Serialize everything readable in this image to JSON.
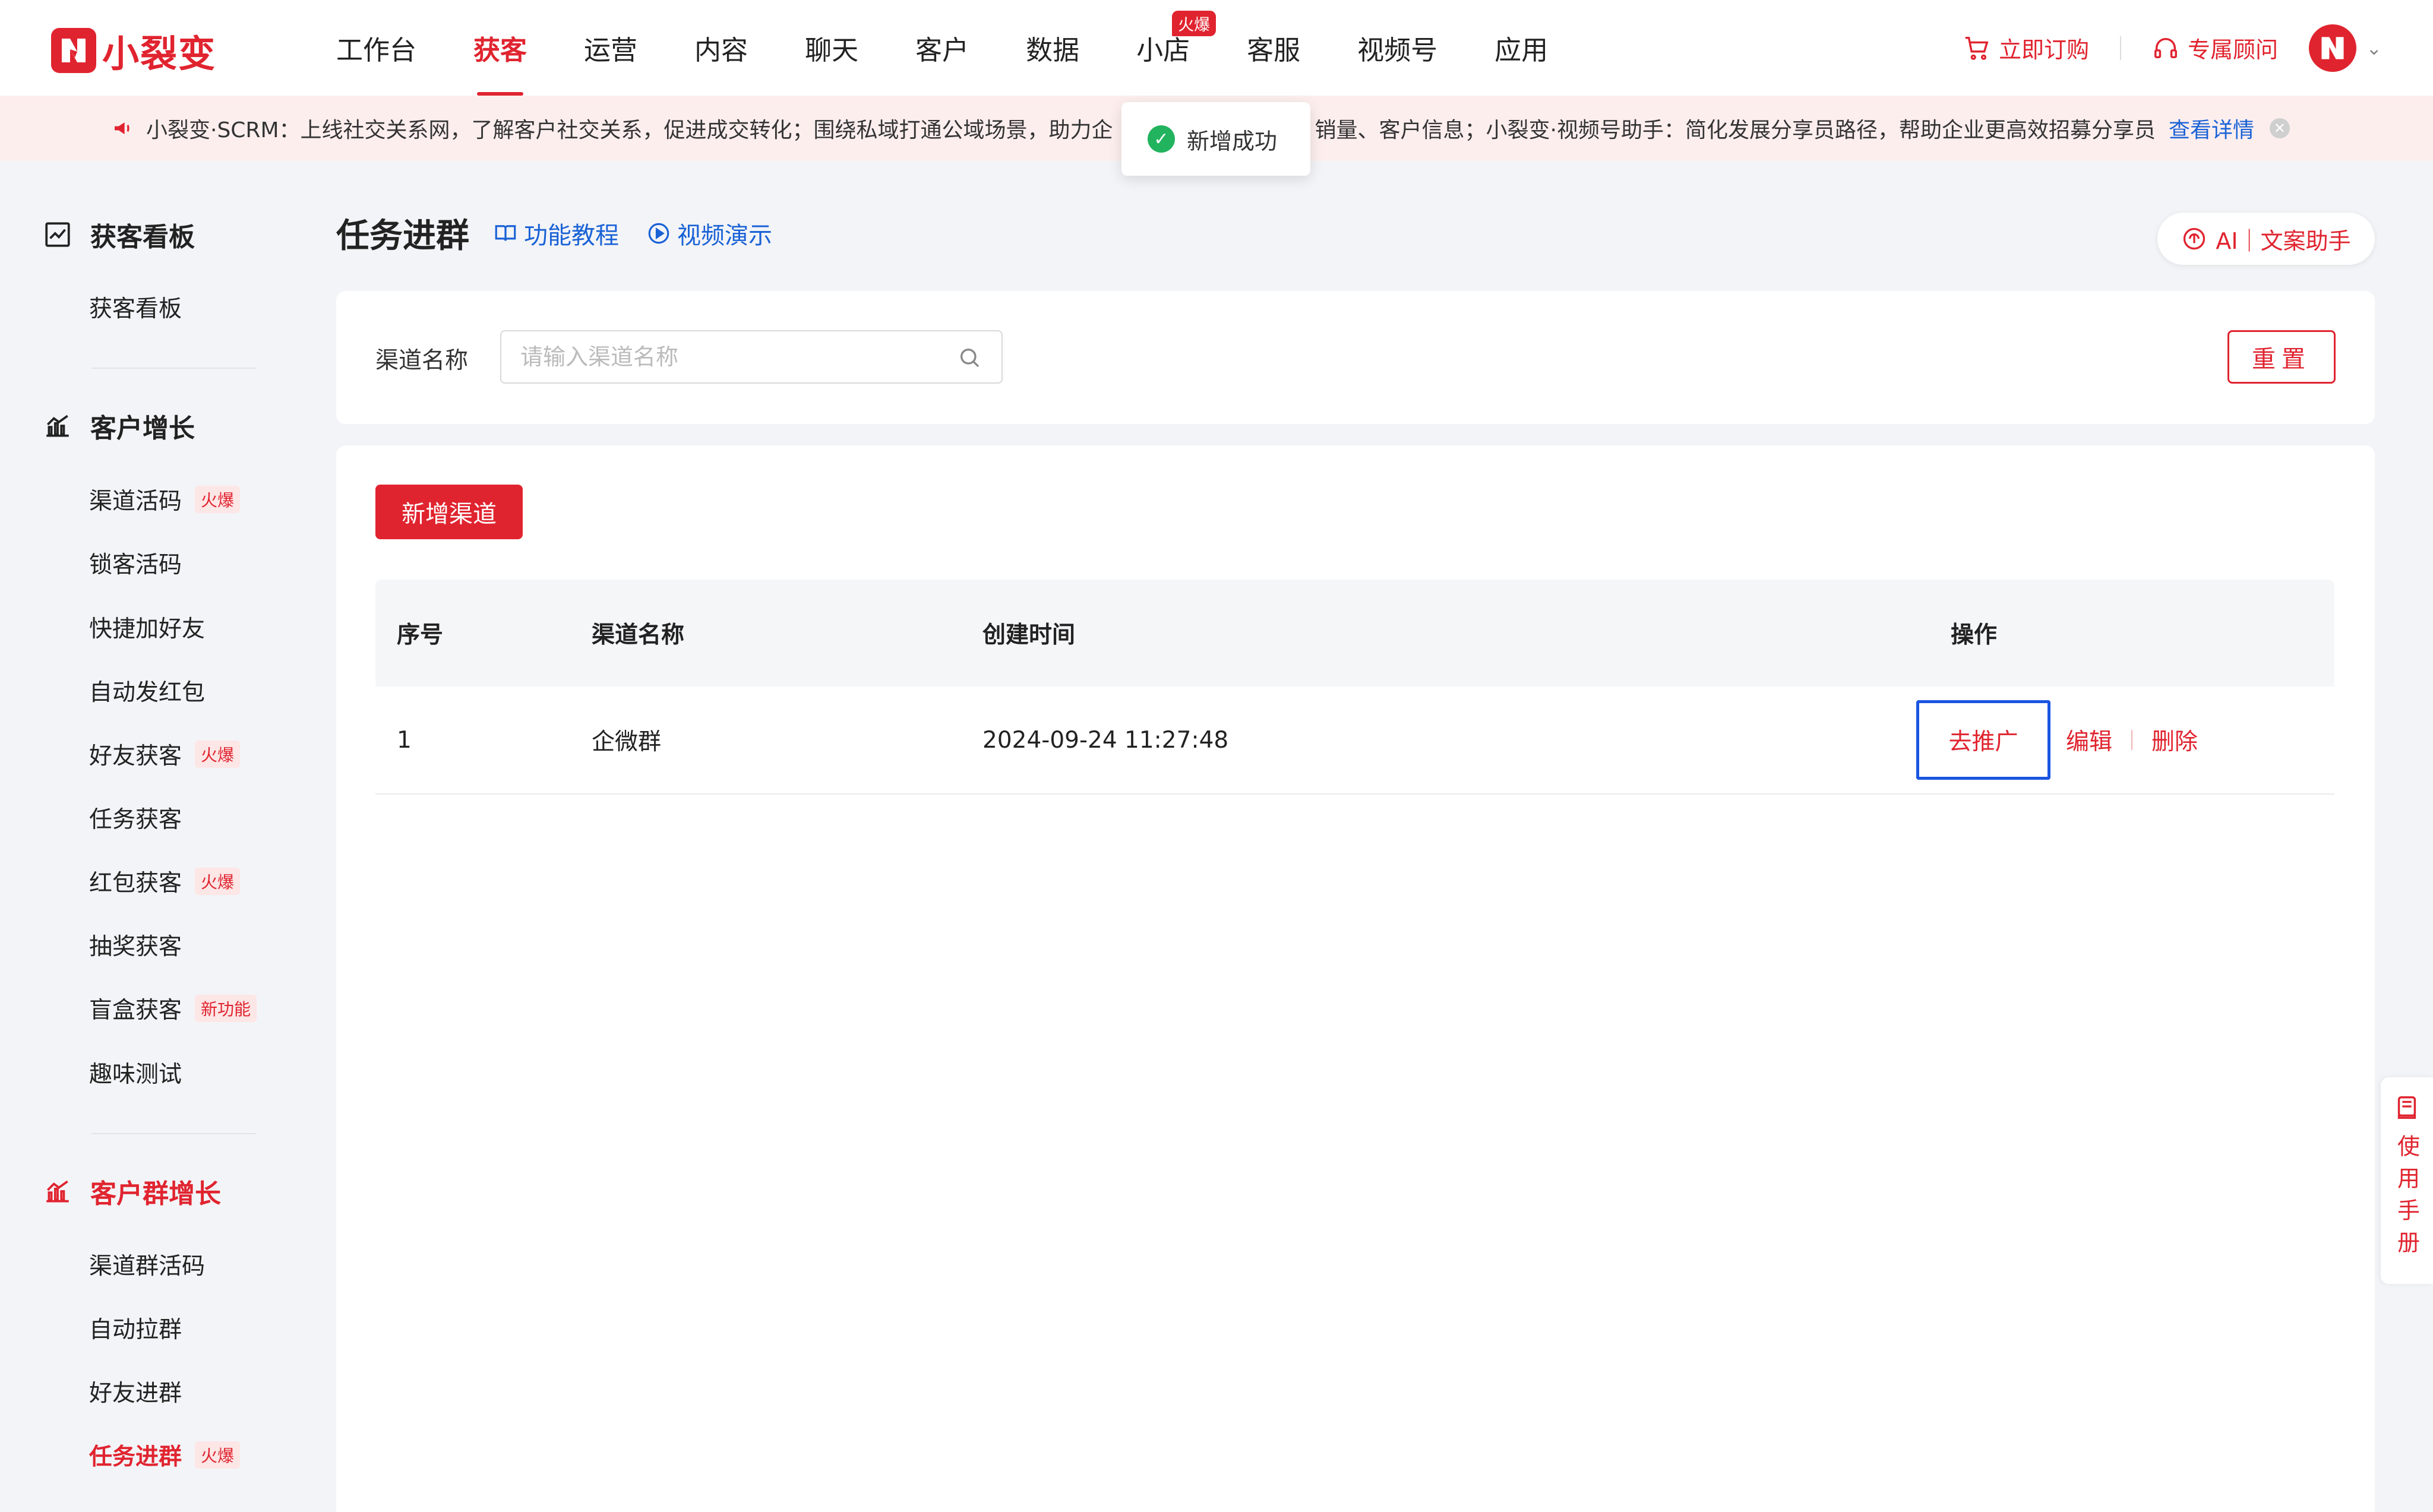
{
  "brand": {
    "name": "小裂变",
    "color": "#e0242f"
  },
  "nav": {
    "items": [
      {
        "label": "工作台"
      },
      {
        "label": "获客",
        "active": true
      },
      {
        "label": "运营"
      },
      {
        "label": "内容"
      },
      {
        "label": "聊天"
      },
      {
        "label": "客户"
      },
      {
        "label": "数据"
      },
      {
        "label": "小店",
        "badge": "火爆"
      },
      {
        "label": "客服"
      },
      {
        "label": "视频号"
      },
      {
        "label": "应用"
      }
    ],
    "order_label": "立即订购",
    "advisor_label": "专属顾问"
  },
  "notice": {
    "text_before": "小裂变·SCRM：上线社交关系网，了解客户社交关系，促进成交转化；围绕私域打通公域场景，助力企",
    "text_after": "销量、客户信息；小裂变·视频号助手：简化发展分享员路径，帮助企业更高效招募分享员",
    "link_label": "查看详情"
  },
  "toast": {
    "message": "新增成功"
  },
  "sidebar": {
    "groups": [
      {
        "title": "获客看板",
        "icon": "chart-line-icon",
        "items": [
          {
            "label": "获客看板"
          }
        ]
      },
      {
        "title": "客户增长",
        "icon": "growth-chart-icon",
        "items": [
          {
            "label": "渠道活码",
            "tag": "火爆"
          },
          {
            "label": "锁客活码"
          },
          {
            "label": "快捷加好友"
          },
          {
            "label": "自动发红包"
          },
          {
            "label": "好友获客",
            "tag": "火爆"
          },
          {
            "label": "任务获客"
          },
          {
            "label": "红包获客",
            "tag": "火爆"
          },
          {
            "label": "抽奖获客"
          },
          {
            "label": "盲盒获客",
            "tag": "新功能"
          },
          {
            "label": "趣味测试"
          }
        ]
      },
      {
        "title": "客户群增长",
        "icon": "growth-chart-icon",
        "active": true,
        "items": [
          {
            "label": "渠道群活码"
          },
          {
            "label": "自动拉群"
          },
          {
            "label": "好友进群"
          },
          {
            "label": "任务进群",
            "tag": "火爆",
            "active": true
          }
        ]
      }
    ]
  },
  "page": {
    "title": "任务进群",
    "tutorial_label": "功能教程",
    "video_label": "视频演示",
    "ai_label": "AI｜文案助手"
  },
  "filter": {
    "channel_label": "渠道名称",
    "channel_placeholder": "请输入渠道名称",
    "channel_value": "",
    "reset_label": "重置"
  },
  "table": {
    "add_label": "新增渠道",
    "columns": [
      "序号",
      "渠道名称",
      "创建时间",
      "操作"
    ],
    "rows": [
      {
        "index": "1",
        "name": "企微群",
        "created": "2024-09-24 11:27:48"
      }
    ],
    "actions": {
      "promote": "去推广",
      "edit": "编辑",
      "delete": "删除"
    }
  },
  "manual": {
    "label": "使用手册"
  }
}
